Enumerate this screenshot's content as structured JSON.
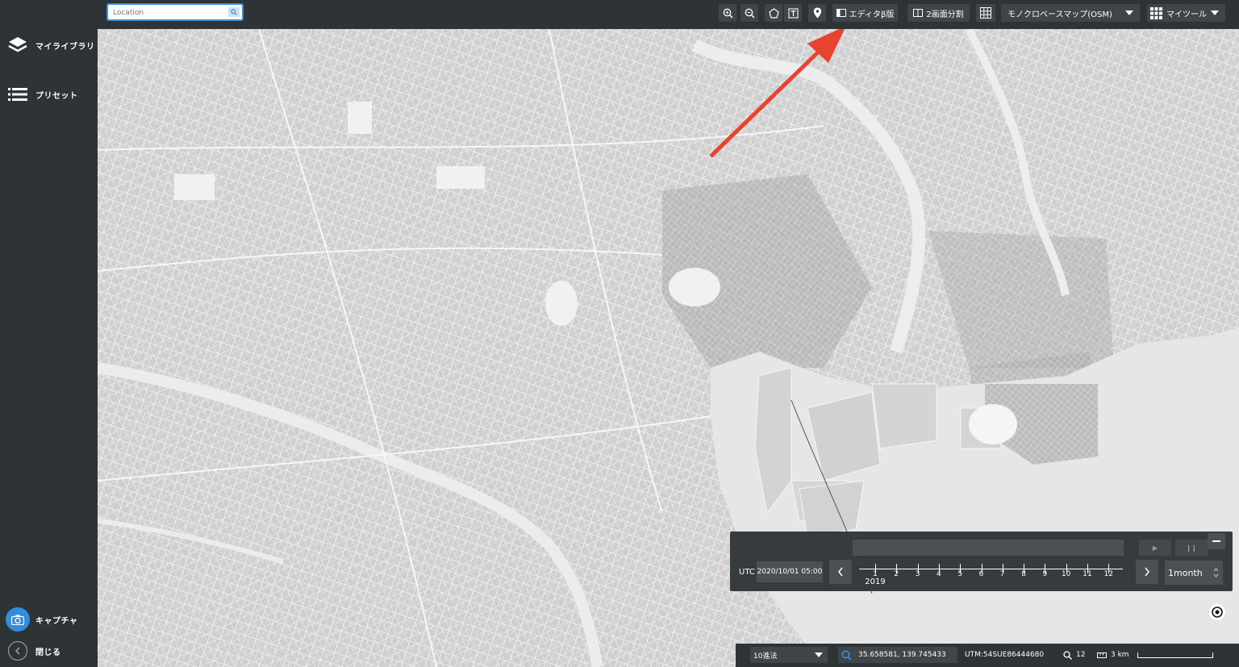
{
  "sidebar": {
    "items": [
      {
        "label": "マイライブラリ",
        "icon": "layers-icon"
      },
      {
        "label": "プリセット",
        "icon": "list-icon"
      }
    ],
    "capture_label": "キャプチャ",
    "close_label": "閉じる"
  },
  "toolbar": {
    "search_placeholder": "Location",
    "editor_label": "エディタβ版",
    "split_label": "2画面分割",
    "basemap_label": "モノクロベースマップ(OSM)",
    "mytools_label": "マイツール"
  },
  "time_panel": {
    "utc_label": "UTC",
    "datetime": "2020/10/01 05:00",
    "months": [
      "1",
      "2",
      "3",
      "4",
      "5",
      "6",
      "7",
      "8",
      "9",
      "10",
      "11",
      "12"
    ],
    "year": "2019",
    "period": "1month"
  },
  "status_bar": {
    "coord_format": "10進法",
    "coordinates": "35.658581, 139.745433",
    "utm": "UTM:54SUE86444680",
    "zoom": "12",
    "scale": "3 km"
  },
  "colors": {
    "sidebar_bg": "#2e3336",
    "accent": "#2f8ee0",
    "annotation_arrow": "#e8432f",
    "map_land": "#d9d9d9",
    "map_water": "#e8e8e8"
  }
}
